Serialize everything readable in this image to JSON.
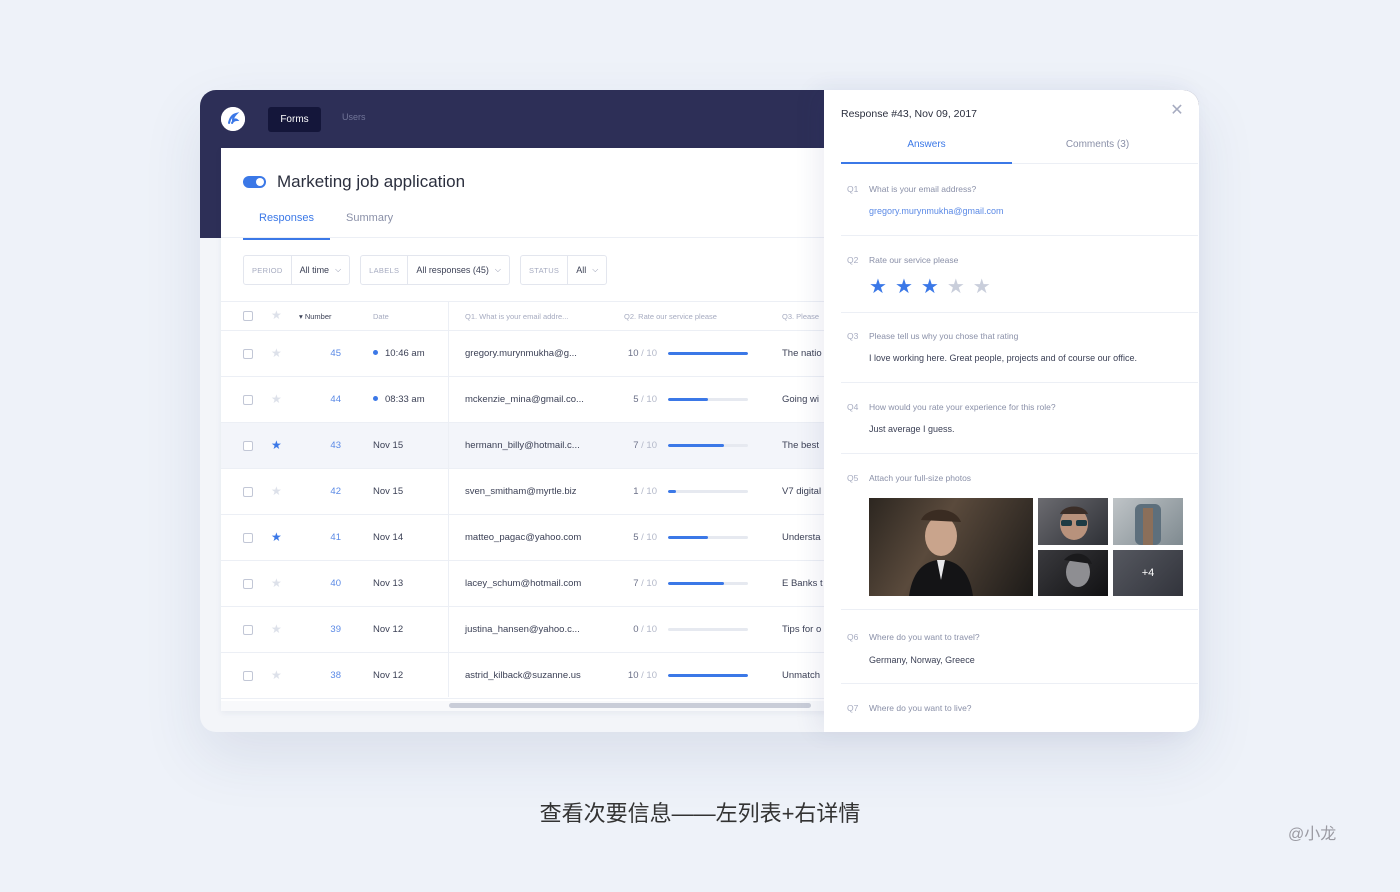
{
  "app": {
    "nav": {
      "forms_label": "Forms",
      "users_label": "Users"
    }
  },
  "form": {
    "title": "Marketing job application",
    "tabs": [
      "Responses",
      "Summary"
    ],
    "active_tab": "Responses"
  },
  "filters": [
    {
      "key": "PERIOD",
      "value": "All time"
    },
    {
      "key": "LABELS",
      "value": "All responses (45)"
    },
    {
      "key": "STATUS",
      "value": "All"
    }
  ],
  "table": {
    "columns": {
      "number": "▾ Number",
      "date": "Date",
      "q1": "Q1. What is your email addre...",
      "q2": "Q2. Rate our service please",
      "q3": "Q3. Please"
    },
    "rows": [
      {
        "number": "45",
        "date": "10:46 am",
        "dot": true,
        "email": "gregory.murynmukha@g...",
        "score": 10,
        "q3": "The natio",
        "starred": false,
        "highlight": false
      },
      {
        "number": "44",
        "date": "08:33 am",
        "dot": true,
        "email": "mckenzie_mina@gmail.co...",
        "score": 5,
        "q3": "Going wi",
        "starred": false,
        "highlight": false
      },
      {
        "number": "43",
        "date": "Nov 15",
        "dot": false,
        "email": "hermann_billy@hotmail.c...",
        "score": 7,
        "q3": "The best",
        "starred": true,
        "highlight": true
      },
      {
        "number": "42",
        "date": "Nov 15",
        "dot": false,
        "email": "sven_smitham@myrtle.biz",
        "score": 1,
        "q3": "V7 digital",
        "starred": false,
        "highlight": false
      },
      {
        "number": "41",
        "date": "Nov 14",
        "dot": false,
        "email": "matteo_pagac@yahoo.com",
        "score": 5,
        "q3": "Understa",
        "starred": true,
        "highlight": false
      },
      {
        "number": "40",
        "date": "Nov 13",
        "dot": false,
        "email": "lacey_schum@hotmail.com",
        "score": 7,
        "q3": "E Banks t",
        "starred": false,
        "highlight": false
      },
      {
        "number": "39",
        "date": "Nov 12",
        "dot": false,
        "email": "justina_hansen@yahoo.c...",
        "score": 0,
        "q3": "Tips for o",
        "starred": false,
        "highlight": false
      },
      {
        "number": "38",
        "date": "Nov 12",
        "dot": false,
        "email": "astrid_kilback@suzanne.us",
        "score": 10,
        "q3": "Unmatch",
        "starred": false,
        "highlight": false
      }
    ],
    "score_max": "/ 10"
  },
  "panel": {
    "title": "Response #43, Nov 09, 2017",
    "tabs": [
      "Answers",
      "Comments (3)"
    ],
    "questions": [
      {
        "label": "Q1",
        "text": "What is your email address?",
        "answer": "gregory.murynmukha@gmail.com"
      },
      {
        "label": "Q2",
        "text": "Rate our service please",
        "rating": 3,
        "rating_max": 5
      },
      {
        "label": "Q3",
        "text": "Please tell us why you chose that rating",
        "answer": "I love working here. Great people, projects and of course our office."
      },
      {
        "label": "Q4",
        "text": "How would you rate your experience for this role?",
        "answer": "Just average I guess."
      },
      {
        "label": "Q5",
        "text": "Attach your full-size photos",
        "more_photos": "+4"
      },
      {
        "label": "Q6",
        "text": "Where do you want to travel?",
        "answer": "Germany, Norway, Greece"
      },
      {
        "label": "Q7",
        "text": "Where do you want to live?"
      }
    ]
  },
  "colors": {
    "accent": "#3b78e7",
    "header": "#2d2f57",
    "nav_active": "#14163a"
  },
  "caption": "查看次要信息——左列表+右详情",
  "watermark": "@小龙"
}
